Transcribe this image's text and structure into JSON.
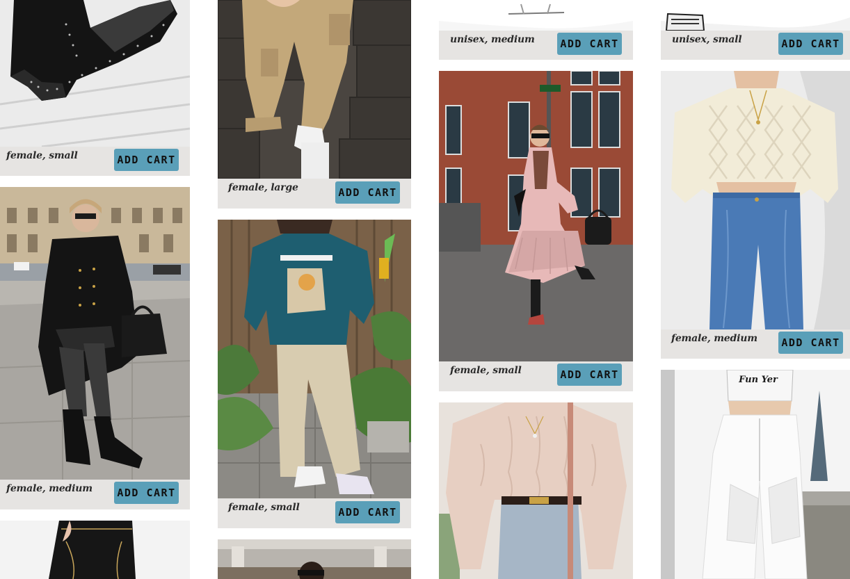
{
  "products": [
    {
      "id": "c1",
      "caption": "female, small",
      "button": "ADD CART",
      "image": "black-studded-chelsea-boot"
    },
    {
      "id": "c2",
      "caption": "female, medium",
      "button": "ADD CART",
      "image": "black-coat-polka-tights-outfit"
    },
    {
      "id": "c3",
      "caption": "",
      "button": "",
      "image": "black-pants-contrast-stitch"
    },
    {
      "id": "c4",
      "caption": "female, large",
      "button": "ADD CART",
      "image": "beige-cargo-pants-white-sneakers"
    },
    {
      "id": "c5",
      "caption": "female, small",
      "button": "ADD CART",
      "image": "teal-sweatshirt-beige-pants"
    },
    {
      "id": "c6",
      "caption": "",
      "button": "",
      "image": "sunglasses-woman-arcade"
    },
    {
      "id": "c7",
      "caption": "unisex, medium",
      "button": "ADD CART",
      "image": "white-item-top-crop"
    },
    {
      "id": "c8",
      "caption": "female, small",
      "button": "ADD CART",
      "image": "pink-trench-coat-street-style"
    },
    {
      "id": "c9",
      "caption": "",
      "button": "",
      "image": "blush-cable-knit-sweater-jeans"
    },
    {
      "id": "c10",
      "caption": "unisex, small",
      "button": "ADD CART",
      "image": "white-sneakers-top-crop"
    },
    {
      "id": "c11",
      "caption": "female, medium",
      "button": "ADD CART",
      "image": "cream-cable-sweater-blue-jeans"
    },
    {
      "id": "c12",
      "caption": "",
      "button": "",
      "image": "white-crop-top-white-cargo-pants",
      "print_text": "Fun Yer"
    }
  ],
  "colors": {
    "card_bg": "#e6e4e2",
    "button_bg": "#5a9fb8",
    "button_text": "#111111",
    "caption_text": "#2a2a2a"
  }
}
